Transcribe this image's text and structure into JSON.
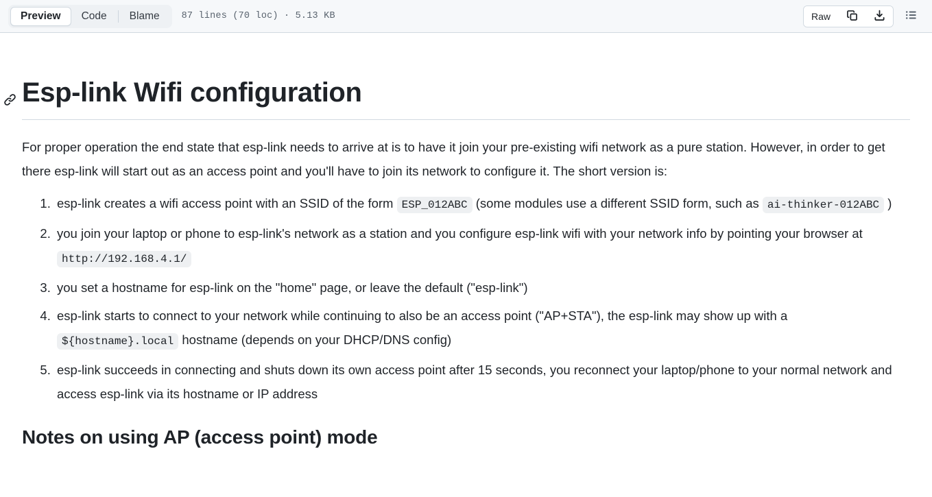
{
  "header": {
    "tabs": [
      {
        "label": "Preview",
        "selected": true
      },
      {
        "label": "Code",
        "selected": false
      },
      {
        "label": "Blame",
        "selected": false
      }
    ],
    "file_meta": "87 lines (70 loc) · 5.13 KB",
    "raw_label": "Raw",
    "icons": {
      "copy": "copy-icon",
      "download": "download-icon",
      "outline": "outline-icon"
    },
    "colors": {
      "header_bg": "#f6f8fa",
      "border": "#d1d9e0",
      "muted_text": "#59636e",
      "text": "#1f2328",
      "code_bg": "#eef0f2",
      "segmented_bg": "#eef1f4"
    }
  },
  "document": {
    "h1": "Esp-link Wifi configuration",
    "anchor_icon": "link-icon",
    "paragraph": "For proper operation the end state that esp-link needs to arrive at is to have it join your pre-existing wifi network as a pure station. However, in order to get there esp-link will start out as an access point and you'll have to join its network to configure it. The short version is:",
    "list": [
      {
        "parts": [
          {
            "type": "text",
            "value": "esp-link creates a wifi access point with an SSID of the form "
          },
          {
            "type": "code",
            "value": "ESP_012ABC"
          },
          {
            "type": "text",
            "value": " (some modules use a different SSID form, such as "
          },
          {
            "type": "code",
            "value": "ai-thinker-012ABC"
          },
          {
            "type": "text",
            "value": " )"
          }
        ]
      },
      {
        "parts": [
          {
            "type": "text",
            "value": "you join your laptop or phone to esp-link's network as a station and you configure esp-link wifi with your network info by pointing your browser at "
          },
          {
            "type": "code",
            "value": "http://192.168.4.1/"
          }
        ]
      },
      {
        "parts": [
          {
            "type": "text",
            "value": "you set a hostname for esp-link on the \"home\" page, or leave the default (\"esp-link\")"
          }
        ]
      },
      {
        "parts": [
          {
            "type": "text",
            "value": "esp-link starts to connect to your network while continuing to also be an access point (\"AP+STA\"), the esp-link may show up with a "
          },
          {
            "type": "code",
            "value": "${hostname}.local"
          },
          {
            "type": "text",
            "value": " hostname (depends on your DHCP/DNS config)"
          }
        ]
      },
      {
        "parts": [
          {
            "type": "text",
            "value": "esp-link succeeds in connecting and shuts down its own access point after 15 seconds, you reconnect your laptop/phone to your normal network and access esp-link via its hostname or IP address"
          }
        ]
      }
    ],
    "h2": "Notes on using AP (access point) mode"
  }
}
